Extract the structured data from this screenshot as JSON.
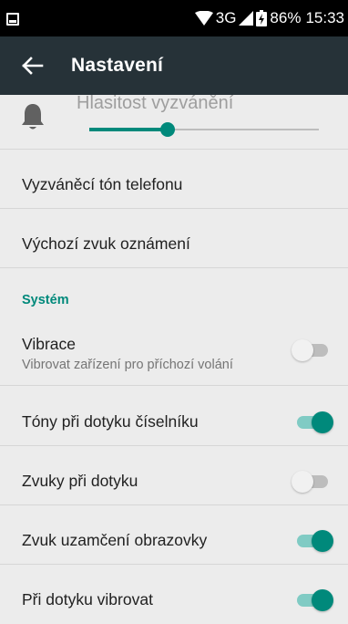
{
  "status_bar": {
    "network": "3G",
    "battery": "86%",
    "time": "15:33"
  },
  "toolbar": {
    "title": "Nastavení"
  },
  "volume": {
    "label": "Hlasitost vyzvánění",
    "level_percent": 34
  },
  "items": {
    "ringtone": {
      "title": "Vyzváněcí tón telefonu"
    },
    "notification_sound": {
      "title": "Výchozí zvuk oznámení"
    }
  },
  "system": {
    "header": "Systém",
    "vibration": {
      "title": "Vibrace",
      "summary": "Vibrovat zařízení pro příchozí volání",
      "enabled": false
    },
    "dialpad_tones": {
      "title": "Tóny při dotyku číselníku",
      "enabled": true
    },
    "touch_sounds": {
      "title": "Zvuky při dotyku",
      "enabled": false
    },
    "screen_lock_sound": {
      "title": "Zvuk uzamčení obrazovky",
      "enabled": true
    },
    "vibrate_on_touch": {
      "title": "Při dotyku vibrovat",
      "enabled": true
    }
  },
  "colors": {
    "accent": "#00897b",
    "toolbar": "#263238",
    "background": "#ececec"
  }
}
